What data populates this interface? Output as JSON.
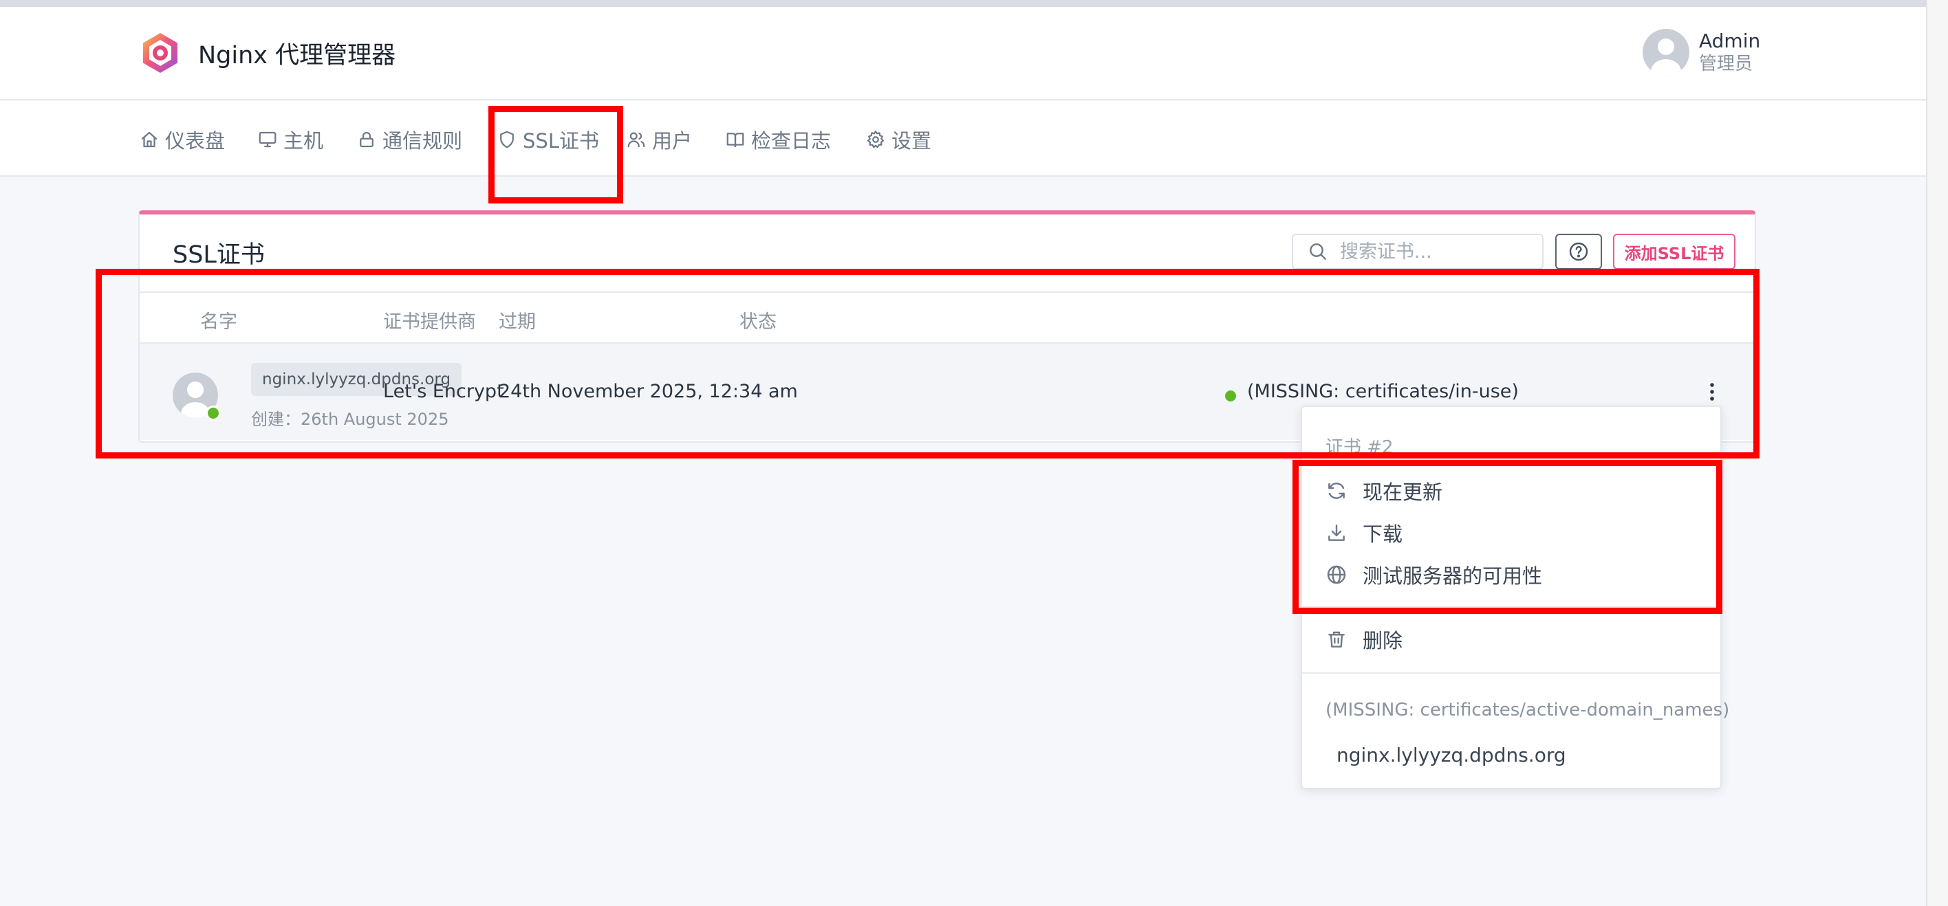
{
  "app": {
    "title": "Nginx 代理管理器"
  },
  "user": {
    "name": "Admin",
    "role": "管理员"
  },
  "nav": {
    "items": [
      {
        "label": "仪表盘",
        "icon": "home-icon"
      },
      {
        "label": "主机",
        "icon": "monitor-icon"
      },
      {
        "label": "通信规则",
        "icon": "lock-icon"
      },
      {
        "label": "SSL证书",
        "icon": "shield-icon"
      },
      {
        "label": "用户",
        "icon": "users-icon"
      },
      {
        "label": "检查日志",
        "icon": "book-icon"
      },
      {
        "label": "设置",
        "icon": "gear-icon"
      }
    ]
  },
  "card": {
    "title": "SSL证书",
    "search_placeholder": "搜索证书...",
    "add_button": "添加SSL证书"
  },
  "table": {
    "columns": [
      "名字",
      "证书提供商",
      "过期",
      "状态"
    ],
    "rows": [
      {
        "domain": "nginx.lylyyzq.dpdns.org",
        "created": "创建：26th August 2025",
        "provider": "Let's Encrypt",
        "expires": "24th November 2025, 12:34 am",
        "status": "(MISSING: certificates/in-use)"
      }
    ]
  },
  "dropdown": {
    "header": "证书 #2",
    "items": [
      {
        "label": "现在更新",
        "icon": "refresh-icon"
      },
      {
        "label": "下载",
        "icon": "download-icon"
      },
      {
        "label": "测试服务器的可用性",
        "icon": "globe-icon"
      },
      {
        "label": "删除",
        "icon": "trash-icon"
      }
    ],
    "section_label": "(MISSING: certificates/active-domain_names)",
    "domain": "nginx.lylyyzq.dpdns.org"
  },
  "colors": {
    "accent": "#ef6f9a",
    "add_button": "#e8457c",
    "status_online": "#5eb724",
    "annotation": "#ff0000"
  }
}
